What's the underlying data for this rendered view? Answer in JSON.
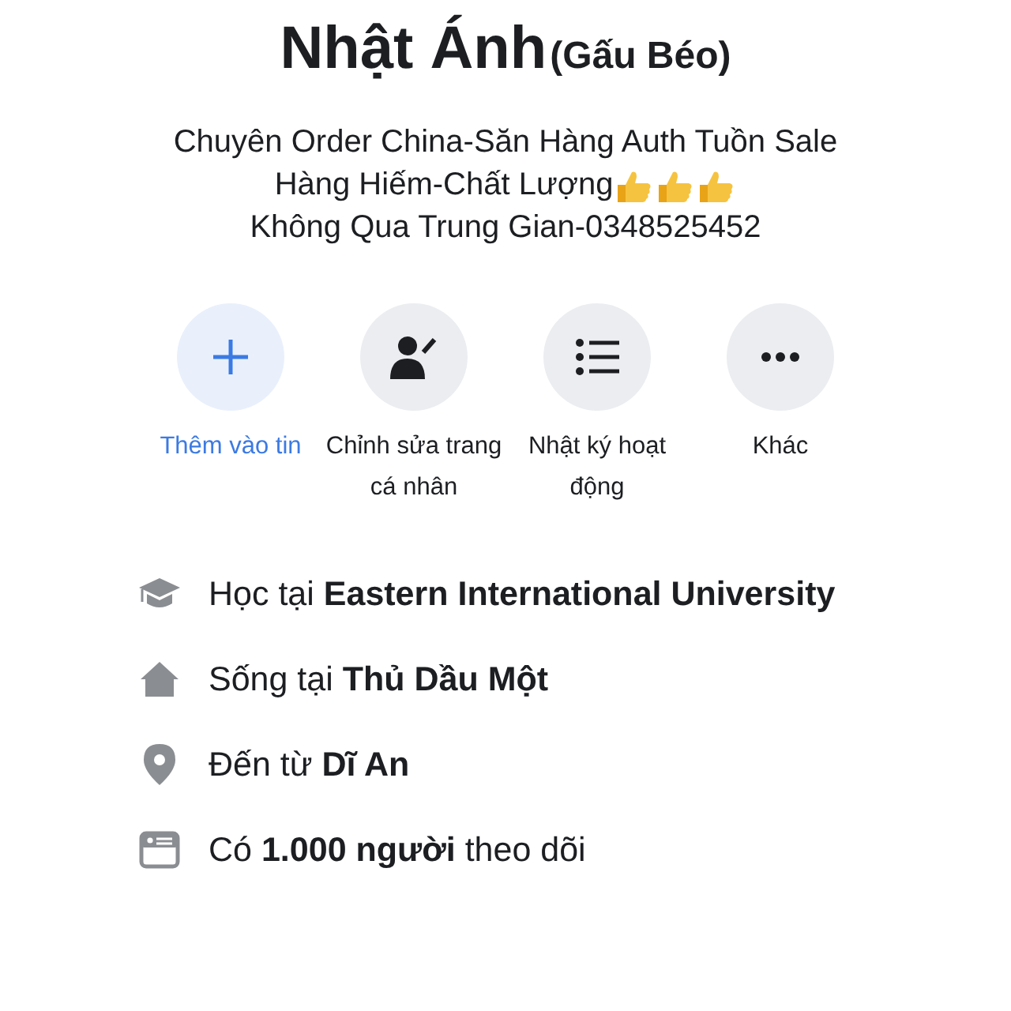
{
  "profile": {
    "name": "Nhật Ánh",
    "nickname": "(Gấu Béo)"
  },
  "bio": [
    {
      "kind": "plain",
      "text": "Chuyên Order China-Săn Hàng Auth Tuồn Sale"
    },
    {
      "kind": "thumbs",
      "text": "Hàng Hiếm-Chất Lượng"
    },
    {
      "kind": "plain",
      "text": "Không Qua Trung Gian-0348525452"
    }
  ],
  "actions": [
    {
      "kind": "add",
      "label": "Thêm vào tin"
    },
    {
      "kind": "edit",
      "label": "Chỉnh sửa trang cá nhân"
    },
    {
      "kind": "log",
      "label": "Nhật ký hoạt động"
    },
    {
      "kind": "more",
      "label": "Khác"
    }
  ],
  "details": [
    {
      "kind": "school",
      "text": "Học tại **Eastern International University**"
    },
    {
      "kind": "home",
      "text": "Sống tại **Thủ Dầu Một**"
    },
    {
      "kind": "origin",
      "text": "Đến từ **Dĩ An**"
    },
    {
      "kind": "followers",
      "text": "Có **1.000 người** theo dõi"
    }
  ]
}
